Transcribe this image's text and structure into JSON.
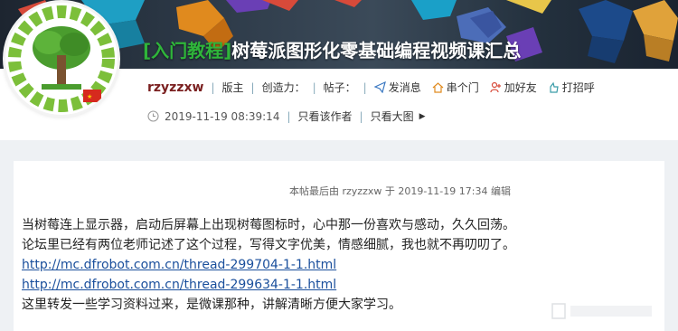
{
  "thread": {
    "title_tag": "[入门教程]",
    "title": "树莓派图形化零基础编程视频课汇总"
  },
  "author": {
    "name": "rzyzzxw",
    "role": "版主",
    "creativity_label": "创造力：",
    "posts_label": "帖子："
  },
  "actions": [
    {
      "icon": "send-message-icon",
      "label": "发消息"
    },
    {
      "icon": "visit-home-icon",
      "label": "串个门"
    },
    {
      "icon": "add-friend-icon",
      "label": "加好友"
    },
    {
      "icon": "say-hello-icon",
      "label": "打招呼"
    }
  ],
  "post_meta": {
    "timestamp": "2019-11-19 08:39:14",
    "only_author": "只看该作者",
    "large_image": "只看大图"
  },
  "post": {
    "edited_note": "本帖最后由 rzyzzxw 于 2019-11-19 17:34 编辑",
    "paragraph1": "当树莓连上显示器，启动后屏幕上出现树莓图标时，心中那一份喜欢与感动，久久回荡。",
    "paragraph2": "论坛里已经有两位老师记述了这个过程，写得文字优美，情感细腻，我也就不再叨叨了。",
    "link1": "http://mc.dfrobot.com.cn/thread-299704-1-1.html",
    "link2": "http://mc.dfrobot.com.cn/thread-299634-1-1.html",
    "paragraph3": "这里转发一些学习资料过来，是微课那种，讲解清晰方便大家学习。"
  },
  "colors": {
    "title_tag": "#2fb53a",
    "username": "#7a1f1f",
    "link": "#1a4f9c"
  }
}
